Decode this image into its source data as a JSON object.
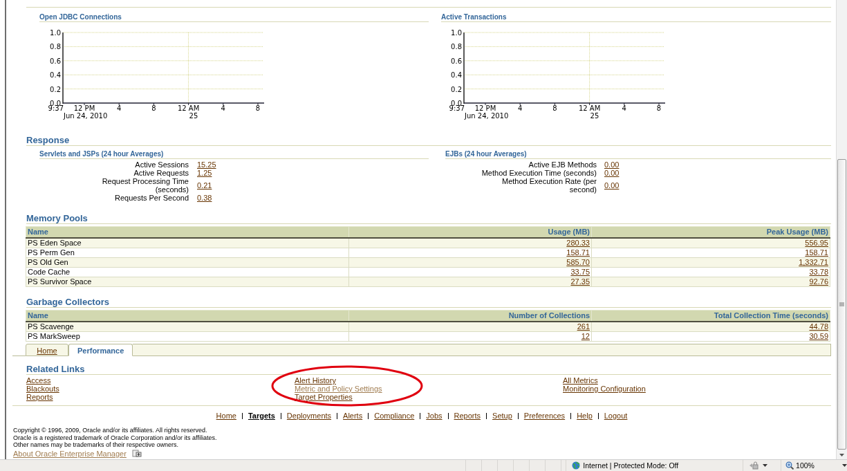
{
  "jdbc_usage": {
    "charts": [
      {
        "title": "Open JDBC Connections",
        "y_labels": [
          "1.0",
          "0.8",
          "0.6",
          "0.4",
          "0.2",
          "0.0"
        ],
        "x_labels": [
          "9:37",
          "12 PM",
          "4",
          "8",
          "12 AM",
          "4",
          "8"
        ],
        "date_labels": [
          "Jun 24, 2010",
          "25"
        ]
      },
      {
        "title": "Active Transactions",
        "y_labels": [
          "1.0",
          "0.8",
          "0.6",
          "0.4",
          "0.2",
          "0.0"
        ],
        "x_labels": [
          "9:37",
          "12 PM",
          "4",
          "8",
          "12 AM",
          "4",
          "8"
        ],
        "date_labels": [
          "Jun 24, 2010",
          "25"
        ]
      }
    ]
  },
  "response": {
    "title": "Response",
    "groups": [
      {
        "title": "Servlets and JSPs (24 hour Averages)",
        "metrics": [
          {
            "label": "Active Sessions",
            "value": "15.25"
          },
          {
            "label": "Active Requests",
            "value": "1.25"
          },
          {
            "label": "Request Processing Time (seconds)",
            "value": "0.21"
          },
          {
            "label": "Requests Per Second",
            "value": "0.38"
          }
        ]
      },
      {
        "title": "EJBs (24 hour Averages)",
        "metrics": [
          {
            "label": "Active EJB Methods",
            "value": "0.00"
          },
          {
            "label": "Method Execution Time (seconds)",
            "value": "0.00"
          },
          {
            "label": "Method Execution Rate (per second)",
            "value": "0.00"
          }
        ]
      }
    ]
  },
  "memory_pools": {
    "title": "Memory Pools",
    "columns": [
      "Name",
      "Usage (MB)",
      "Peak Usage (MB)"
    ],
    "rows": [
      [
        "PS Eden Space",
        "280.33",
        "556.95"
      ],
      [
        "PS Perm Gen",
        "158.71",
        "158.71"
      ],
      [
        "PS Old Gen",
        "585.70",
        "1,332.71"
      ],
      [
        "Code Cache",
        "33.75",
        "33.78"
      ],
      [
        "PS Survivor Space",
        "27.35",
        "92.76"
      ]
    ]
  },
  "garbage_collectors": {
    "title": "Garbage Collectors",
    "columns": [
      "Name",
      "Number of Collections",
      "Total Collection Time (seconds)"
    ],
    "rows": [
      [
        "PS Scavenge",
        "261",
        "44.78"
      ],
      [
        "PS MarkSweep",
        "12",
        "30.59"
      ]
    ]
  },
  "tabs": [
    {
      "label": "Home",
      "selected": false
    },
    {
      "label": "Performance",
      "selected": true
    }
  ],
  "related_links": {
    "title": "Related Links",
    "columns": [
      [
        {
          "label": "Access",
          "visited": false
        },
        {
          "label": "Blackouts",
          "visited": false
        },
        {
          "label": "Reports",
          "visited": false
        }
      ],
      [
        {
          "label": "Alert History",
          "visited": false
        },
        {
          "label": "Metric and Policy Settings",
          "visited": true
        },
        {
          "label": "Target Properties",
          "visited": false
        }
      ],
      [
        {
          "label": "All Metrics",
          "visited": false
        },
        {
          "label": "Monitoring Configuration",
          "visited": false
        }
      ]
    ]
  },
  "footer_nav": [
    {
      "label": "Home",
      "selected": false
    },
    {
      "label": "Targets",
      "selected": true
    },
    {
      "label": "Deployments",
      "selected": false
    },
    {
      "label": "Alerts",
      "selected": false
    },
    {
      "label": "Compliance",
      "selected": false
    },
    {
      "label": "Jobs",
      "selected": false
    },
    {
      "label": "Reports",
      "selected": false
    },
    {
      "label": "Setup",
      "selected": false
    },
    {
      "label": "Preferences",
      "selected": false
    },
    {
      "label": "Help",
      "selected": false
    },
    {
      "label": "Logout",
      "selected": false
    }
  ],
  "copyright": [
    "Copyright © 1996, 2009, Oracle and/or its affiliates. All rights reserved.",
    "Oracle is a registered trademark of Oracle Corporation and/or its affiliates.",
    "Other names may be trademarks of their respective owners."
  ],
  "about_link": {
    "label": "About Oracle Enterprise Manager",
    "visited": true
  },
  "status_bar": {
    "zone": "Internet | Protected Mode: Off",
    "zoom": "100%"
  }
}
